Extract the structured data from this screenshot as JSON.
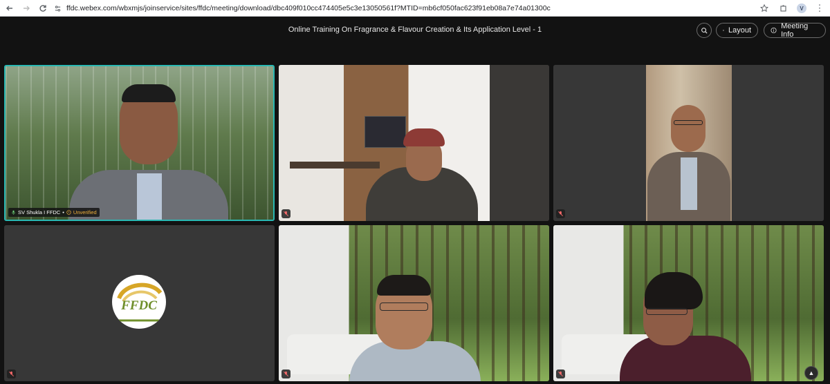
{
  "browser": {
    "url": "ffdc.webex.com/wbxmjs/joinservice/sites/ffdc/meeting/download/dbc409f010cc474405e5c3e13050561f?MTID=mb6cf050fac623f91eb08a7e74a01300c",
    "profile_initial": "V"
  },
  "meeting": {
    "title": "Online Training On Fragrance & Flavour Creation & Its Application Level - 1",
    "layout_label": "Layout",
    "info_label": "Meeting Info"
  },
  "participants": [
    {
      "name": "SV Shukla I FFDC",
      "status": "Unverified",
      "active_speaker": true
    },
    {
      "name": "",
      "muted": true
    },
    {
      "name": "",
      "muted": true
    },
    {
      "logo_text": "FFDC",
      "muted": true
    },
    {
      "name": "",
      "muted": true
    },
    {
      "name": "",
      "muted": true
    }
  ],
  "colors": {
    "active_border": "#29b8b3",
    "unverified": "#f2b13a"
  }
}
